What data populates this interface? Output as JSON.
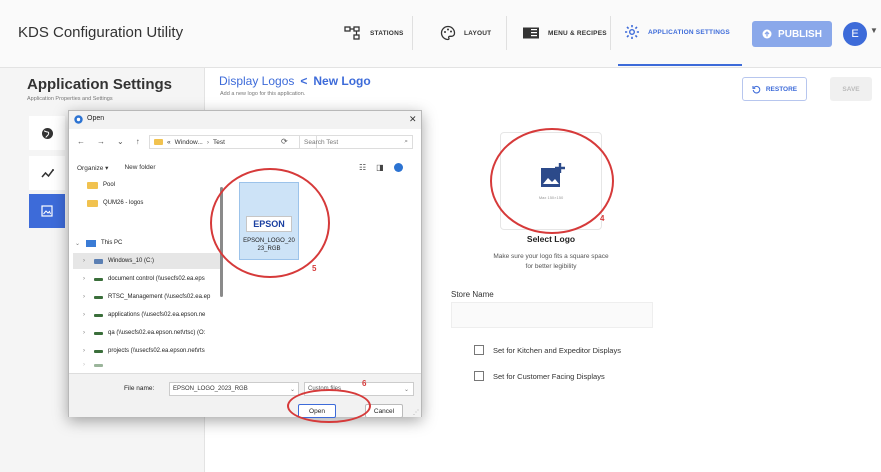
{
  "app": {
    "title": "KDS Configuration Utility"
  },
  "nav": {
    "stations": "STATIONS",
    "layout": "LAYOUT",
    "menu_recipes": "MENU & RECIPES",
    "application_settings": "APPLICATION SETTINGS",
    "publish": "PUBLISH",
    "avatar_initial": "E"
  },
  "left_panel": {
    "title": "Application Settings",
    "subtitle": "Application Properties and Settings"
  },
  "main": {
    "breadcrumb_parent": "Display Logos",
    "breadcrumb_separator": "<",
    "breadcrumb_current": "New Logo",
    "subtitle": "Add a new logo for this application.",
    "restore": "RESTORE",
    "save": "SAVE",
    "logo_box_caption": "Max 150×150",
    "select_logo": "Select Logo",
    "select_hint": "Make sure your logo fits a square space for better legibility",
    "store_name_label": "Store Name",
    "store_name_value": "",
    "check_kitchen": "Set for Kitchen and Expeditor Displays",
    "check_customer": "Set for Customer Facing Displays"
  },
  "annotations": {
    "n4": "4",
    "n5": "5",
    "n6": "6"
  },
  "dialog": {
    "title": "Open",
    "close": "✕",
    "path_prefix": "«",
    "path_segment1": "Window...",
    "path_chevron": "›",
    "path_segment2": "Test",
    "search_placeholder": "Search Test",
    "organize": "Organize ▾",
    "new_folder": "New folder",
    "tree": {
      "pool": "Pool",
      "qum": "QUM26 - logos",
      "this_pc": "This PC",
      "windows": "Windows_10 (C:)",
      "doc_control": "document control (\\\\usecfs02.ea.eps",
      "rtsc": "RTSC_Management (\\\\usecfs02.ea.ep",
      "applications": "applications (\\\\usecfs02.ea.epson.ne",
      "qa": "qa (\\\\usecfs02.ea.epson.net\\rtsc) (O:",
      "projects": "projects (\\\\usecfs02.ea.epson.net\\rts"
    },
    "file": {
      "logo_text": "EPSON",
      "name_line1": "EPSON_LOGO_20",
      "name_line2": "23_RGB"
    },
    "file_name_label": "File name:",
    "file_name_value": "EPSON_LOGO_2023_RGB",
    "file_type": "Custom files",
    "open": "Open",
    "cancel": "Cancel"
  },
  "colors": {
    "accent": "#3d6bd9",
    "annotation": "#d63a3a"
  }
}
